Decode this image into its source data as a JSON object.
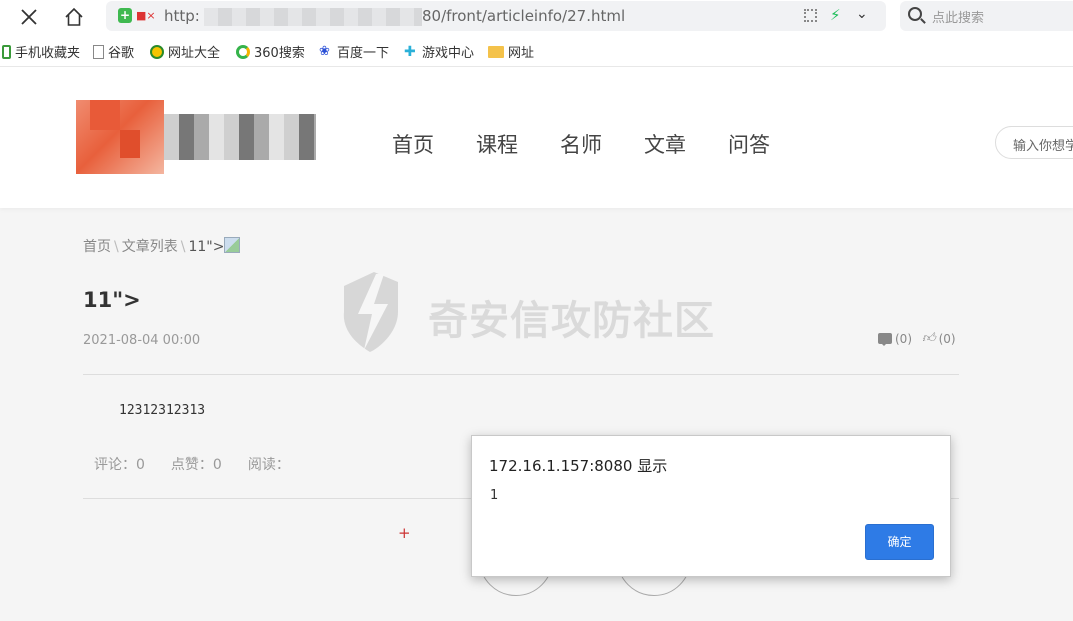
{
  "browser": {
    "url_protocol": "http:",
    "url_rest": "80/front/articleinfo/27.html",
    "search_placeholder": "点此搜索",
    "icons": [
      "close-icon",
      "home-icon",
      "shield-icon",
      "qr-code-icon",
      "bolt-icon",
      "chevron-down-icon",
      "search-icon"
    ]
  },
  "bookmarks": [
    {
      "label": "手机收藏夹",
      "icon": "phone-icon"
    },
    {
      "label": "谷歌",
      "icon": "page-icon"
    },
    {
      "label": "网址大全",
      "icon": "globe-icon"
    },
    {
      "label": "360搜索",
      "icon": "search-360-icon"
    },
    {
      "label": "百度一下",
      "icon": "paw-icon"
    },
    {
      "label": "游戏中心",
      "icon": "gamepad-icon"
    },
    {
      "label": "网址",
      "icon": "folder-icon"
    }
  ],
  "site": {
    "nav": [
      "首页",
      "课程",
      "名师",
      "文章",
      "问答"
    ],
    "search_placeholder": "输入你想学"
  },
  "breadcrumb": {
    "home": "首页",
    "list": "文章列表",
    "current": "11\">"
  },
  "article": {
    "title": "11\">",
    "date": "2021-08-04 00:00",
    "comment_count": "(0)",
    "like_count": "(0)",
    "body": "12312312313",
    "stats": {
      "comments": "评论：0",
      "likes": "点赞：0",
      "reads": "阅读："
    },
    "plus": "+"
  },
  "watermark": "奇安信攻防社区",
  "dialog": {
    "title": "172.16.1.157:8080 显示",
    "message": "1",
    "ok_label": "确定"
  },
  "colors": {
    "accent": "#2e7be6",
    "logo_red": "#e8603c",
    "bolt_green": "#20c05c"
  }
}
